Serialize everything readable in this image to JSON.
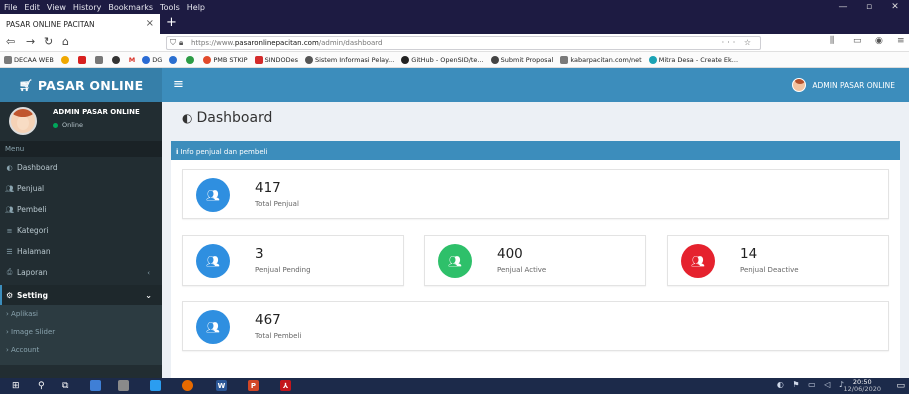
{
  "browser": {
    "menu": [
      "File",
      "Edit",
      "View",
      "History",
      "Bookmarks",
      "Tools",
      "Help"
    ],
    "tab_title": "PASAR ONLINE PACITAN",
    "tab_close": "×",
    "new_tab": "+",
    "url_prefix": "https://www.",
    "url_host": "pasaronlinepacitan.com",
    "url_path": "/admin/dashboard",
    "url_actions": "··· ☆",
    "bookmarks": [
      {
        "label": "DECAA WEB",
        "color": "#7a7a7a"
      },
      {
        "label": "",
        "color": "#f0a800"
      },
      {
        "label": "",
        "color": "#d8201f"
      },
      {
        "label": "",
        "color": "#777777"
      },
      {
        "label": "",
        "color": "#333333"
      },
      {
        "label": "M",
        "color": ""
      },
      {
        "label": "DG",
        "color": "#2a6bd4"
      },
      {
        "label": "",
        "color": "#2b6fd0"
      },
      {
        "label": "",
        "color": "#2d9c45"
      },
      {
        "label": "PMB STKIP",
        "color": "#e24a2a"
      },
      {
        "label": "SINDODes",
        "color": "#d42b2b"
      },
      {
        "label": "Sistem Informasi Pelay...",
        "color": "#555555"
      },
      {
        "label": "GitHub - OpenSID/te...",
        "color": "#222222"
      },
      {
        "label": "Submit Proposal",
        "color": "#444444"
      },
      {
        "label": "kabarpacitan.com/net",
        "color": "#7a7a7a"
      },
      {
        "label": "Mitra Desa - Create Ek...",
        "color": "#1aa3b5"
      }
    ]
  },
  "header": {
    "logo_text": "PASAR ONLINE",
    "user_name": "ADMIN PASAR ONLINE",
    "colors": {
      "bar": "#3c8dbc",
      "logo": "#367fa9"
    }
  },
  "sidebar": {
    "user_name": "ADMIN PASAR ONLINE",
    "user_status": "Online",
    "menu_header": "Menu",
    "items": [
      {
        "label": "Dashboard",
        "icon": "dashboard-icon"
      },
      {
        "label": "Penjual",
        "icon": "users-icon"
      },
      {
        "label": "Pembeli",
        "icon": "users-icon"
      },
      {
        "label": "Kategori",
        "icon": "list-icon"
      },
      {
        "label": "Halaman",
        "icon": "list-icon"
      },
      {
        "label": "Laporan",
        "icon": "print-icon"
      }
    ],
    "setting_label": "Setting",
    "sub_items": [
      "Aplikasi",
      "Image Slider",
      "Account"
    ]
  },
  "content": {
    "page_title": "Dashboard",
    "box_title": "Info penjual dan pembeli",
    "stats": {
      "total_penjual": {
        "value": "417",
        "label": "Total Penjual",
        "color": "#2f8fe0"
      },
      "pending": {
        "value": "3",
        "label": "Penjual Pending",
        "color": "#2f8fe0"
      },
      "active": {
        "value": "400",
        "label": "Penjual Active",
        "color": "#2ec06a"
      },
      "deactive": {
        "value": "14",
        "label": "Penjual Deactive",
        "color": "#e5222e"
      },
      "total_pembeli": {
        "value": "467",
        "label": "Total Pembeli",
        "color": "#2f8fe0"
      }
    }
  },
  "taskbar": {
    "time": "20:50",
    "date": "12/06/2020"
  }
}
